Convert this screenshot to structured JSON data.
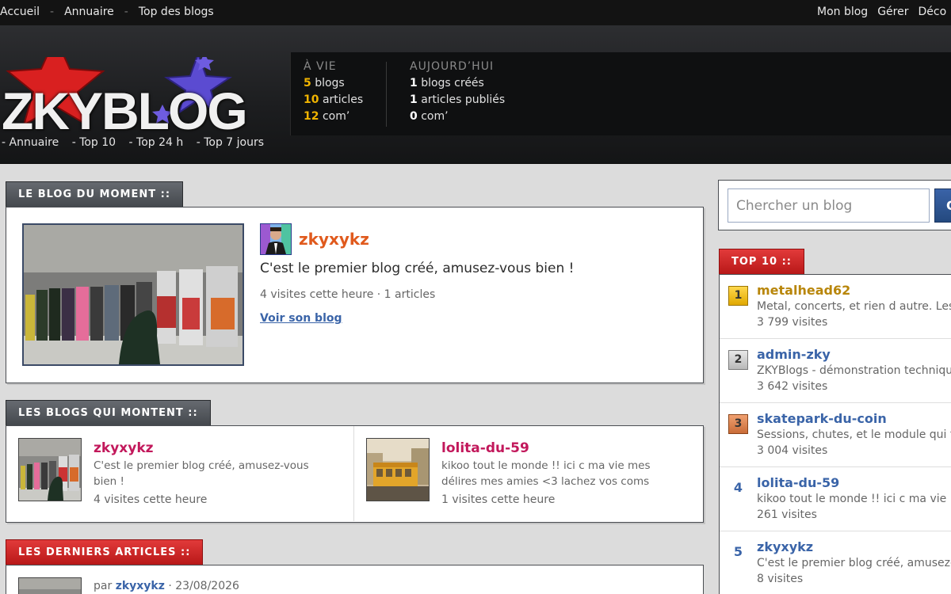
{
  "topbar": {
    "left": [
      "Accueil",
      "Annuaire",
      "Top des blogs"
    ],
    "right": [
      "Mon blog",
      "Gérer",
      "Déco"
    ],
    "separator": "-"
  },
  "header": {
    "logo_text": "ZKYBLOG",
    "subnav": [
      "- Annuaire",
      "- Top 10",
      "- Top 24 h",
      "- Top 7 jours"
    ]
  },
  "stats": {
    "lifetime": {
      "heading": "À vie",
      "rows": [
        {
          "num": "5",
          "label": "blogs"
        },
        {
          "num": "10",
          "label": "articles"
        },
        {
          "num": "12",
          "label": "com’"
        }
      ]
    },
    "today": {
      "heading": "Aujourd’hui",
      "rows": [
        {
          "num": "1",
          "label": "blogs créés"
        },
        {
          "num": "1",
          "label": "articles publiés"
        },
        {
          "num": "0",
          "label": "com’"
        }
      ]
    }
  },
  "moment": {
    "section_label": "LE BLOG DU MOMENT ::",
    "name": "zkyxykz",
    "description": "C'est le premier blog créé, amusez-vous bien !",
    "stats": "4 visites cette heure · 1 articles",
    "link": "Voir son blog"
  },
  "rising": {
    "section_label": "LES BLOGS QUI MONTENT ::",
    "items": [
      {
        "name": "zkyxykz",
        "description": "C'est le premier blog créé, amusez-vous bien !",
        "visits": "4 visites cette heure"
      },
      {
        "name": "lolita-du-59",
        "description": "kikoo tout le monde !! ici c ma vie mes délires mes amies <3 lachez vos coms",
        "visits": "1 visites cette heure"
      }
    ]
  },
  "latest": {
    "section_label": "LES DERNIERS ARTICLES ::",
    "prefix": "par",
    "author": "zkyxykz",
    "date": "· 23/08/2026"
  },
  "search": {
    "placeholder": "Chercher un blog",
    "button_label": "O"
  },
  "top10": {
    "section_label": "TOP 10 ::",
    "items": [
      {
        "rank": "1",
        "name": "metalhead62",
        "description": "Metal, concerts, et rien d autre. Les",
        "visits": "3 799 visites"
      },
      {
        "rank": "2",
        "name": "admin-zky",
        "description": "ZKYBlogs - démonstration technique",
        "visits": "3 642 visites"
      },
      {
        "rank": "3",
        "name": "skatepark-du-coin",
        "description": "Sessions, chutes, et le module qui t",
        "visits": "3 004 visites"
      },
      {
        "rank": "4",
        "name": "lolita-du-59",
        "description": "kikoo tout le monde !! ici c ma vie m",
        "visits": "261 visites"
      },
      {
        "rank": "5",
        "name": "zkyxykz",
        "description": "C'est le premier blog créé, amusez-",
        "visits": "8 visites"
      }
    ]
  },
  "colors": {
    "accent_red": "#c81e1e",
    "link_blue": "#3a64a8",
    "name_orange": "#e05a1d",
    "name_pink": "#c2185b",
    "stat_gold": "#f0b400"
  }
}
